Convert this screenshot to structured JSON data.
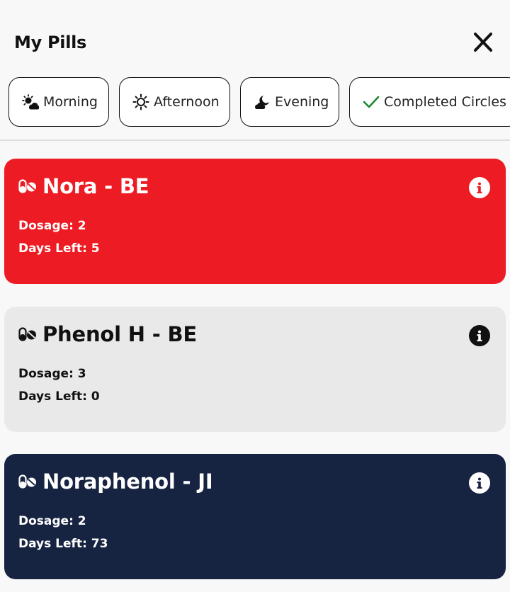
{
  "header": {
    "title": "My Pills",
    "close_icon": "close-icon"
  },
  "filters": [
    {
      "label": "Morning",
      "icon": "sun-cloud-icon"
    },
    {
      "label": "Afternoon",
      "icon": "sun-icon"
    },
    {
      "label": "Evening",
      "icon": "moon-cloud-icon"
    },
    {
      "label": "Completed Circles",
      "icon": "check-icon",
      "icon_color": "#1a8a2e"
    }
  ],
  "pills": [
    {
      "name": "Nora - BE",
      "dosage_label": "Dosage: 2",
      "days_label": "Days Left: 5",
      "color": "#ed1c24",
      "icon": "pills-icon"
    },
    {
      "name": "Phenol H - BE",
      "dosage_label": "Dosage: 3",
      "days_label": "Days Left: 0",
      "color": "#e9e9e9",
      "icon": "pills-icon"
    },
    {
      "name": "Noraphenol - JI",
      "dosage_label": "Dosage: 2",
      "days_label": "Days Left: 73",
      "color": "#162341",
      "icon": "pills-icon"
    }
  ]
}
